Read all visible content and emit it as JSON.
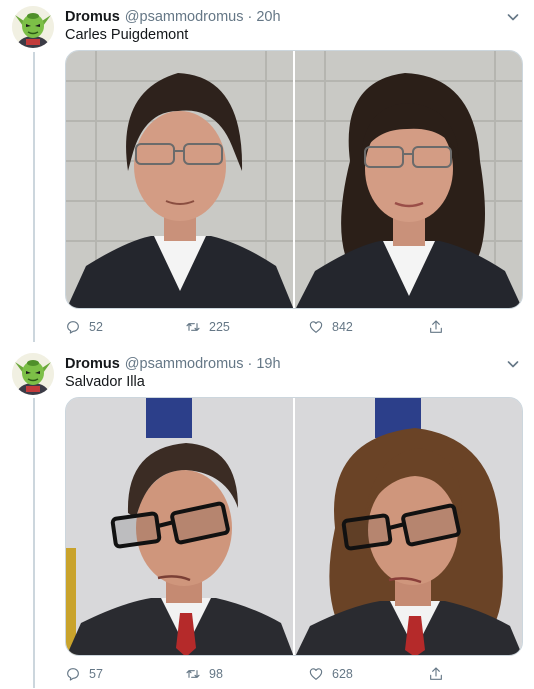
{
  "tweets": [
    {
      "name": "Dromus",
      "handle": "@psammodromus",
      "separator": "·",
      "time": "20h",
      "text": "Carles Puigdemont",
      "replies": "52",
      "retweets": "225",
      "likes": "842"
    },
    {
      "name": "Dromus",
      "handle": "@psammodromus",
      "separator": "·",
      "time": "19h",
      "text": "Salvador Illa",
      "replies": "57",
      "retweets": "98",
      "likes": "628"
    }
  ],
  "colors": {
    "accent": "#1da1f2",
    "text_primary": "#14171a",
    "text_secondary": "#657786",
    "thread_line": "#ccd6dd"
  },
  "icons": {
    "reply": "reply-icon",
    "retweet": "retweet-icon",
    "like": "heart-icon",
    "share": "share-icon",
    "more": "chevron-down-icon"
  }
}
